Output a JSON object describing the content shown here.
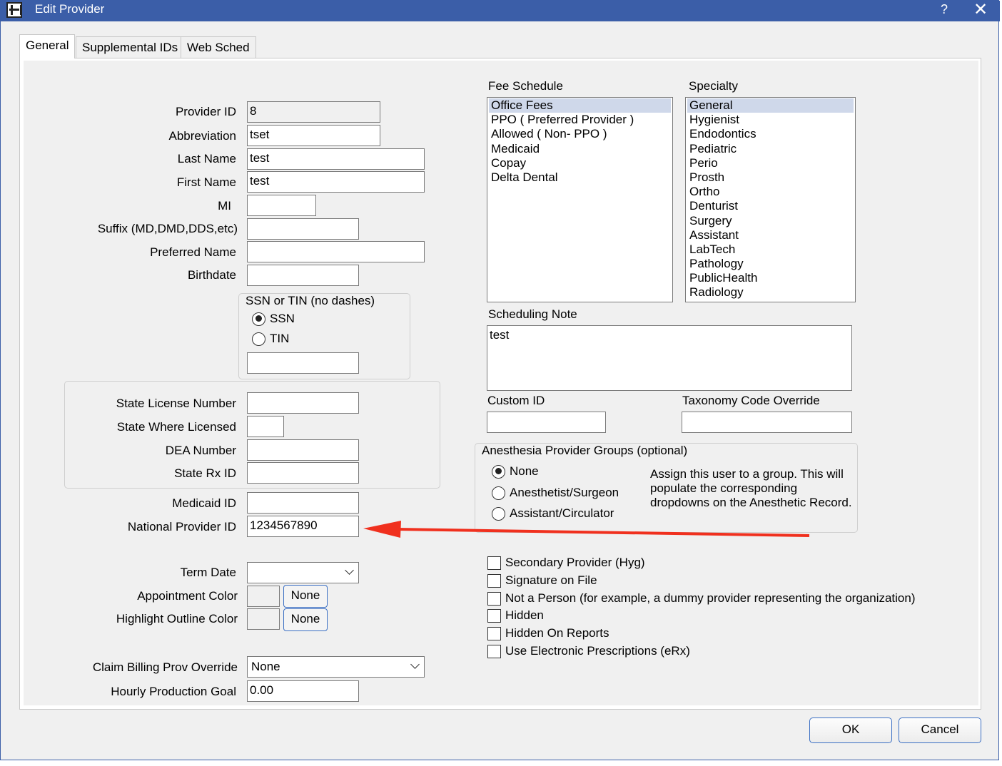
{
  "window": {
    "title": "Edit Provider",
    "help": "?",
    "close": "✕"
  },
  "tabs": [
    "General",
    "Supplemental IDs",
    "Web Sched"
  ],
  "fields": {
    "provider_id": {
      "label": "Provider ID",
      "value": "8"
    },
    "abbreviation": {
      "label": "Abbreviation",
      "value": "tset"
    },
    "last_name": {
      "label": "Last Name",
      "value": "test"
    },
    "first_name": {
      "label": "First Name",
      "value": "test"
    },
    "mi": {
      "label": "MI",
      "value": ""
    },
    "suffix": {
      "label": "Suffix (MD,DMD,DDS,etc)",
      "value": ""
    },
    "preferred_name": {
      "label": "Preferred Name",
      "value": ""
    },
    "birthdate": {
      "label": "Birthdate",
      "value": ""
    },
    "state_license": {
      "label": "State License Number",
      "value": ""
    },
    "state_where_licensed": {
      "label": "State Where Licensed",
      "value": ""
    },
    "dea_number": {
      "label": "DEA Number",
      "value": ""
    },
    "state_rx_id": {
      "label": "State Rx ID",
      "value": ""
    },
    "medicaid_id": {
      "label": "Medicaid ID",
      "value": ""
    },
    "npi": {
      "label": "National Provider ID",
      "value": "1234567890"
    },
    "term_date": {
      "label": "Term Date",
      "value": ""
    },
    "appointment_color": {
      "label": "Appointment Color",
      "button": "None"
    },
    "highlight_color": {
      "label": "Highlight Outline Color",
      "button": "None"
    },
    "claim_billing": {
      "label": "Claim Billing Prov Override",
      "value": "None"
    },
    "hourly_goal": {
      "label": "Hourly Production Goal",
      "value": "0.00"
    },
    "custom_id": {
      "label": "Custom ID",
      "value": ""
    },
    "taxonomy": {
      "label": "Taxonomy Code Override",
      "value": ""
    }
  },
  "ssn_group": {
    "title": "SSN or TIN (no dashes)",
    "options": [
      "SSN",
      "TIN"
    ],
    "selected": "SSN",
    "value": ""
  },
  "fee_schedule": {
    "label": "Fee Schedule",
    "items": [
      "Office Fees",
      "PPO ( Preferred Provider )",
      "Allowed ( Non- PPO )",
      "Medicaid",
      "Copay",
      "Delta Dental"
    ],
    "selected": "Office Fees"
  },
  "specialty": {
    "label": "Specialty",
    "items": [
      "General",
      "Hygienist",
      "Endodontics",
      "Pediatric",
      "Perio",
      "Prosth",
      "Ortho",
      "Denturist",
      "Surgery",
      "Assistant",
      "LabTech",
      "Pathology",
      "PublicHealth",
      "Radiology"
    ],
    "selected": "General"
  },
  "scheduling_note": {
    "label": "Scheduling Note",
    "value": "test"
  },
  "anesthesia": {
    "title": "Anesthesia Provider Groups (optional)",
    "options": [
      "None",
      "Anesthetist/Surgeon",
      "Assistant/Circulator"
    ],
    "selected": "None",
    "description": "Assign this user to a group. This will populate the corresponding dropdowns on the Anesthetic Record."
  },
  "checkboxes": [
    "Secondary Provider (Hyg)",
    "Signature on File",
    "Not a Person (for example, a dummy provider representing the organization)",
    "Hidden",
    "Hidden On Reports",
    "Use Electronic Prescriptions (eRx)"
  ],
  "buttons": {
    "ok": "OK",
    "cancel": "Cancel"
  },
  "colors": {
    "titlebar": "#3b5ea8",
    "annotation_arrow": "#f0301e",
    "selection": "#cfd8ea"
  }
}
